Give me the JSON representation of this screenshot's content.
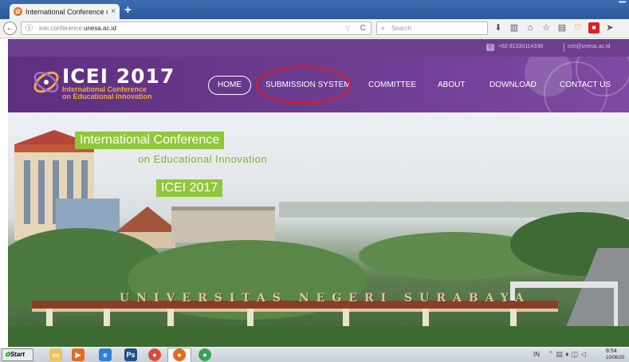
{
  "browser": {
    "tab_title": "International Conference on Edu",
    "tab_close": "×",
    "new_tab": "+",
    "back": "←",
    "info": "ⓘ",
    "url_prefix": "icei.conference.",
    "url_host": "unesa.ac.id",
    "url_dropdown": "▽",
    "reload": "C",
    "search_placeholder": "Search",
    "toolbar_icons": [
      "download-icon",
      "library-icon",
      "home-icon",
      "bookmark-star-icon",
      "pocket-list-icon",
      "pocket-icon",
      "extension-icon",
      "send-icon"
    ]
  },
  "site": {
    "phone": "+62 81330114338",
    "email": "icei@unesa.ac.id",
    "logo_title": "ICEI 2017",
    "logo_sub_line1": "International Conference",
    "logo_sub_line2": "on Educational Innovation",
    "nav": {
      "home": "HOME",
      "submission": "SUBMISSION SYSTEM",
      "committee": "COMMITTEE",
      "about": "ABOUT",
      "download": "DOWNLOAD",
      "contact": "CONTACT US"
    },
    "hero": {
      "banner_title": "International Conference",
      "banner_subtitle": "on Educational Innovation",
      "banner_event": "ICEI 2017",
      "campus_sign": "UNIVERSITAS NEGERI SURABAYA"
    },
    "colors": {
      "header_purple": "#6d3d92",
      "accent_orange": "#f2a93a",
      "banner_green": "#8fc83a",
      "annotation_red": "#e11a1a"
    }
  },
  "taskbar": {
    "start": "Start",
    "apps": [
      "explorer-icon",
      "media-player-icon",
      "internet-explorer-icon",
      "photoshop-icon",
      "chrome-icon",
      "firefox-icon",
      "chrome-alt-icon"
    ],
    "photoshop_label": "Ps",
    "language": "IN",
    "time": "8:54",
    "date": "10/06/20"
  }
}
